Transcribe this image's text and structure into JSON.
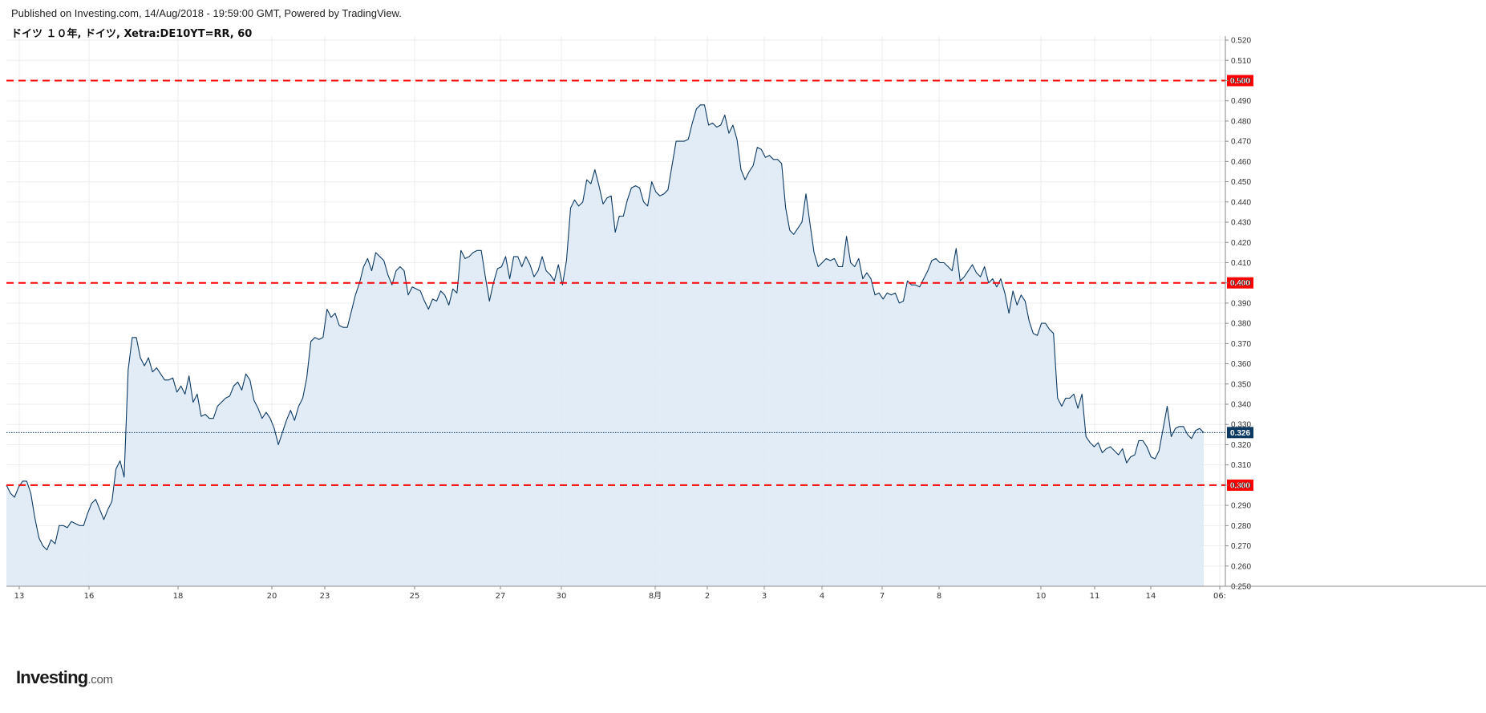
{
  "header": {
    "published": "Published on Investing.com, 14/Aug/2018 - 19:59:00 GMT, Powered by TradingView.",
    "symbol": "ドイツ １０年, ドイツ, Xetra:DE10YT=RR, 60"
  },
  "logo": {
    "main": "Investing",
    "suffix": ".com"
  },
  "colors": {
    "line": "#0d3a63",
    "area_fill": "#dce9f6",
    "grid": "#eeeeee",
    "hline": "#ff0000",
    "hline_label_bg": "#ff0000",
    "current_label_bg": "#0d3a63"
  },
  "chart_data": {
    "type": "area",
    "title": "ドイツ １０年, ドイツ, Xetra:DE10YT=RR, 60",
    "ylim": [
      0.25,
      0.522
    ],
    "y_ticks": [
      "0.250",
      "0.260",
      "0.270",
      "0.280",
      "0.290",
      "0.300",
      "0.310",
      "0.320",
      "0.330",
      "0.340",
      "0.350",
      "0.360",
      "0.370",
      "0.380",
      "0.390",
      "0.400",
      "0.410",
      "0.420",
      "0.430",
      "0.440",
      "0.450",
      "0.460",
      "0.470",
      "0.480",
      "0.490",
      "0.500",
      "0.510",
      "0.520"
    ],
    "x_ticks": [
      "13",
      "16",
      "18",
      "20",
      "23",
      "25",
      "27",
      "30",
      "8月",
      "2",
      "3",
      "4",
      "7",
      "8",
      "10",
      "11",
      "14",
      "06:"
    ],
    "horizontal_lines": [
      {
        "value": 0.5,
        "label": "0.500"
      },
      {
        "value": 0.4,
        "label": "0.400"
      },
      {
        "value": 0.3,
        "label": "0.300"
      }
    ],
    "current": {
      "value": 0.326,
      "label": "0.326"
    },
    "series": [
      {
        "values": [
          0.3,
          0.296,
          0.294,
          0.299,
          0.302,
          0.302,
          0.296,
          0.284,
          0.274,
          0.27,
          0.268,
          0.273,
          0.271,
          0.28,
          0.28,
          0.279,
          0.282,
          0.281,
          0.28,
          0.28,
          0.286,
          0.291,
          0.293,
          0.288,
          0.283,
          0.288,
          0.292,
          0.308,
          0.312,
          0.304,
          0.357,
          0.373,
          0.373,
          0.363,
          0.359,
          0.363,
          0.356,
          0.358,
          0.355,
          0.352,
          0.352,
          0.353,
          0.346,
          0.349,
          0.345,
          0.354,
          0.341,
          0.345,
          0.334,
          0.335,
          0.333,
          0.333,
          0.339,
          0.341,
          0.343,
          0.344,
          0.349,
          0.351,
          0.347,
          0.355,
          0.352,
          0.342,
          0.338,
          0.333,
          0.336,
          0.333,
          0.328,
          0.32,
          0.326,
          0.332,
          0.337,
          0.332,
          0.339,
          0.343,
          0.353,
          0.371,
          0.373,
          0.372,
          0.373,
          0.387,
          0.383,
          0.385,
          0.379,
          0.378,
          0.378,
          0.386,
          0.394,
          0.4,
          0.408,
          0.412,
          0.406,
          0.415,
          0.413,
          0.411,
          0.404,
          0.399,
          0.406,
          0.408,
          0.406,
          0.394,
          0.398,
          0.397,
          0.396,
          0.391,
          0.387,
          0.392,
          0.391,
          0.396,
          0.394,
          0.389,
          0.397,
          0.395,
          0.416,
          0.412,
          0.413,
          0.415,
          0.416,
          0.416,
          0.403,
          0.391,
          0.4,
          0.407,
          0.408,
          0.413,
          0.402,
          0.413,
          0.413,
          0.408,
          0.413,
          0.409,
          0.403,
          0.406,
          0.413,
          0.406,
          0.404,
          0.401,
          0.409,
          0.399,
          0.411,
          0.437,
          0.441,
          0.438,
          0.44,
          0.451,
          0.449,
          0.456,
          0.448,
          0.439,
          0.442,
          0.443,
          0.425,
          0.433,
          0.433,
          0.441,
          0.447,
          0.448,
          0.447,
          0.44,
          0.438,
          0.45,
          0.445,
          0.443,
          0.444,
          0.446,
          0.458,
          0.47,
          0.47,
          0.47,
          0.471,
          0.479,
          0.486,
          0.488,
          0.488,
          0.478,
          0.479,
          0.477,
          0.478,
          0.483,
          0.474,
          0.478,
          0.471,
          0.456,
          0.451,
          0.455,
          0.458,
          0.467,
          0.466,
          0.462,
          0.463,
          0.461,
          0.461,
          0.459,
          0.437,
          0.426,
          0.424,
          0.427,
          0.43,
          0.444,
          0.429,
          0.415,
          0.408,
          0.41,
          0.412,
          0.411,
          0.412,
          0.408,
          0.408,
          0.423,
          0.41,
          0.408,
          0.412,
          0.402,
          0.405,
          0.402,
          0.394,
          0.395,
          0.392,
          0.395,
          0.394,
          0.395,
          0.39,
          0.391,
          0.401,
          0.399,
          0.399,
          0.398,
          0.402,
          0.406,
          0.411,
          0.412,
          0.41,
          0.41,
          0.408,
          0.406,
          0.417,
          0.401,
          0.403,
          0.406,
          0.409,
          0.405,
          0.403,
          0.408,
          0.4,
          0.402,
          0.398,
          0.402,
          0.395,
          0.385,
          0.396,
          0.389,
          0.394,
          0.391,
          0.381,
          0.375,
          0.374,
          0.38,
          0.38,
          0.377,
          0.375,
          0.343,
          0.339,
          0.343,
          0.343,
          0.345,
          0.338,
          0.345,
          0.324,
          0.321,
          0.319,
          0.321,
          0.316,
          0.318,
          0.319,
          0.317,
          0.315,
          0.318,
          0.311,
          0.314,
          0.315,
          0.322,
          0.322,
          0.319,
          0.314,
          0.313,
          0.317,
          0.328,
          0.339,
          0.324,
          0.328,
          0.329,
          0.329,
          0.325,
          0.323,
          0.327,
          0.328,
          0.326
        ]
      }
    ],
    "grid": true
  }
}
